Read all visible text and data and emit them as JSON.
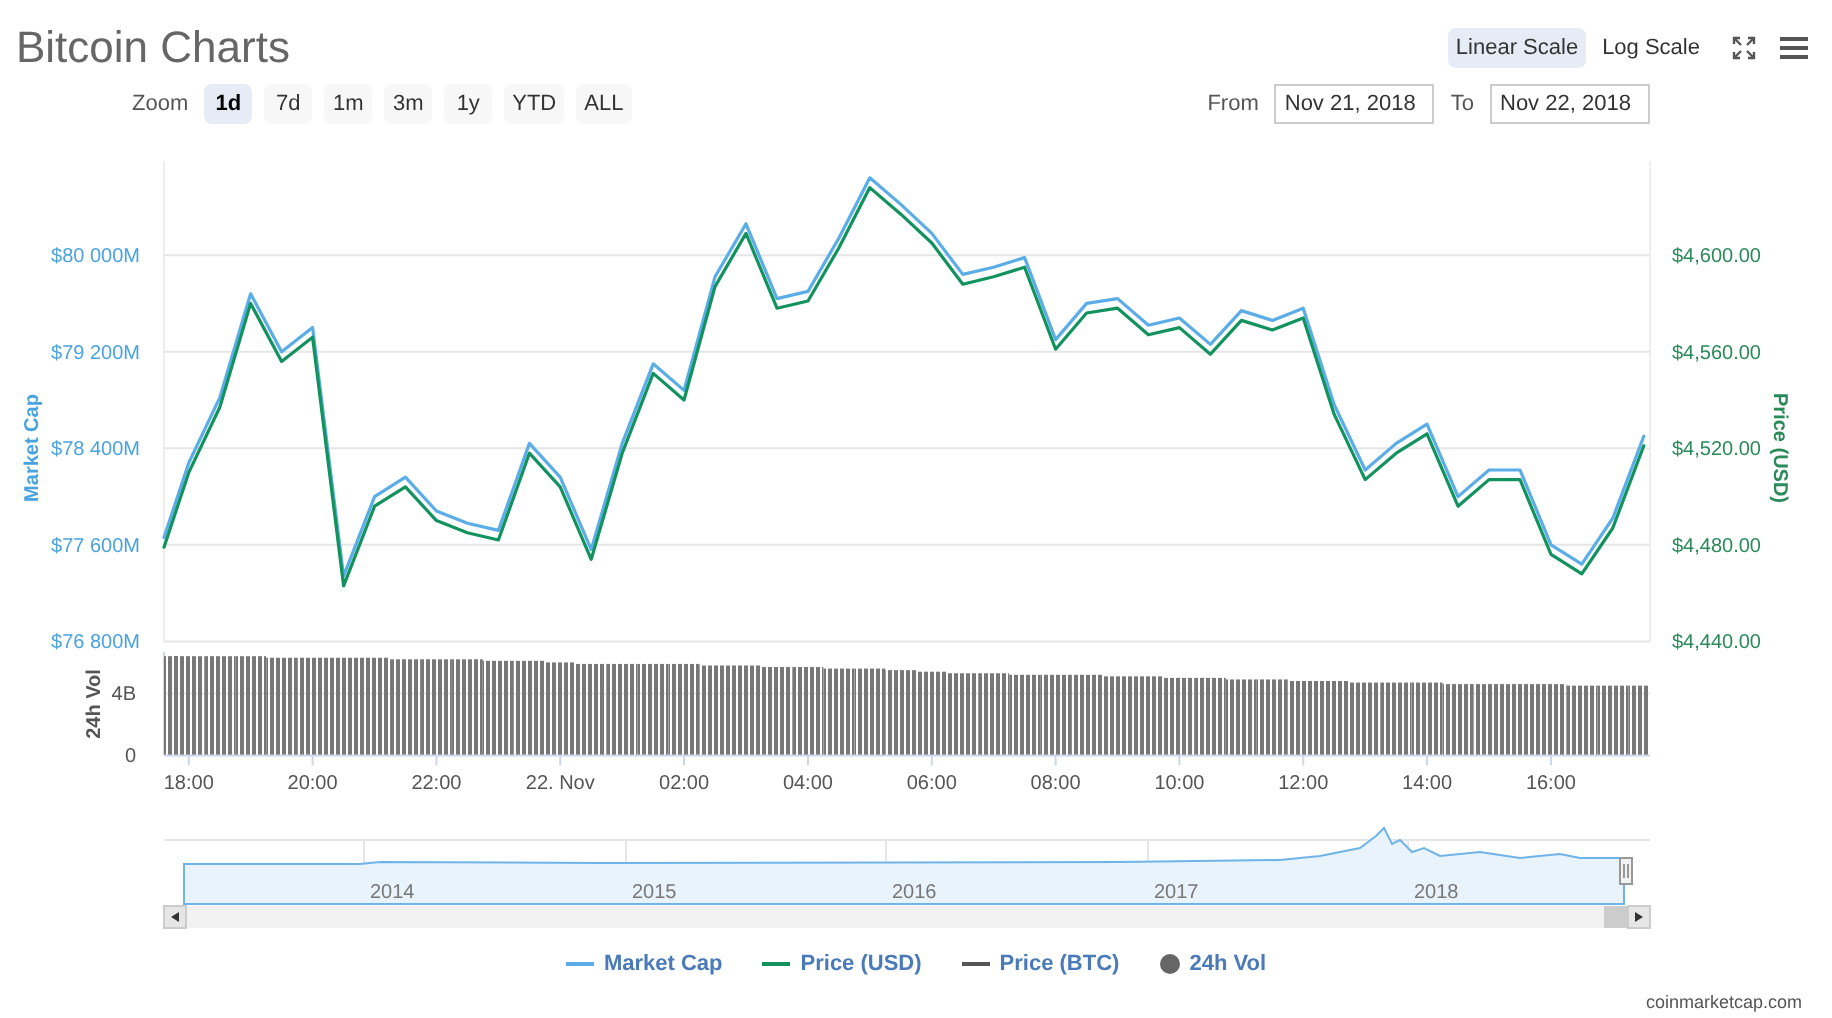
{
  "title": "Bitcoin Charts",
  "scale_buttons": [
    {
      "label": "Linear Scale",
      "selected": true
    },
    {
      "label": "Log Scale",
      "selected": false
    }
  ],
  "zoom": {
    "label": "Zoom",
    "options": [
      {
        "label": "1d",
        "selected": true
      },
      {
        "label": "7d",
        "selected": false
      },
      {
        "label": "1m",
        "selected": false
      },
      {
        "label": "3m",
        "selected": false
      },
      {
        "label": "1y",
        "selected": false
      },
      {
        "label": "YTD",
        "selected": false
      },
      {
        "label": "ALL",
        "selected": false
      }
    ]
  },
  "range": {
    "from_label": "From",
    "from": "Nov 21, 2018",
    "to_label": "To",
    "to": "Nov 22, 2018"
  },
  "price_chart": {
    "chart_data": {
      "type": "line",
      "ylabel": "Market Cap",
      "y2label": "Price (USD)",
      "xlim": [
        "2018-11-21 17:36",
        "2018-11-22 17:36"
      ],
      "ylim": [
        76800,
        80780
      ],
      "y2lim": [
        4440,
        4639
      ],
      "grid": true,
      "yticks": [
        {
          "value": 76800,
          "label": "$76 800M"
        },
        {
          "value": 77600,
          "label": "$77 600M"
        },
        {
          "value": 78400,
          "label": "$78 400M"
        },
        {
          "value": 79200,
          "label": "$79 200M"
        },
        {
          "value": 80000,
          "label": "$80 000M"
        }
      ],
      "y2ticks": [
        {
          "value": 4440,
          "label": "$4,440.00"
        },
        {
          "value": 4480,
          "label": "$4,480.00"
        },
        {
          "value": 4520,
          "label": "$4,520.00"
        },
        {
          "value": 4560,
          "label": "$4,560.00"
        },
        {
          "value": 4600,
          "label": "$4,600.00"
        }
      ],
      "x": [
        "2018-11-21 17:36",
        "2018-11-21 18:00",
        "2018-11-21 18:30",
        "2018-11-21 19:00",
        "2018-11-21 19:30",
        "2018-11-21 20:00",
        "2018-11-21 20:30",
        "2018-11-21 21:00",
        "2018-11-21 21:30",
        "2018-11-21 22:00",
        "2018-11-21 22:30",
        "2018-11-21 23:00",
        "2018-11-21 23:30",
        "2018-11-22 00:00",
        "2018-11-22 00:30",
        "2018-11-22 01:00",
        "2018-11-22 01:30",
        "2018-11-22 02:00",
        "2018-11-22 02:30",
        "2018-11-22 03:00",
        "2018-11-22 03:30",
        "2018-11-22 04:00",
        "2018-11-22 04:30",
        "2018-11-22 05:00",
        "2018-11-22 05:30",
        "2018-11-22 06:00",
        "2018-11-22 06:30",
        "2018-11-22 07:00",
        "2018-11-22 07:30",
        "2018-11-22 08:00",
        "2018-11-22 08:30",
        "2018-11-22 09:00",
        "2018-11-22 09:30",
        "2018-11-22 10:00",
        "2018-11-22 10:30",
        "2018-11-22 11:00",
        "2018-11-22 11:30",
        "2018-11-22 12:00",
        "2018-11-22 12:30",
        "2018-11-22 13:00",
        "2018-11-22 13:30",
        "2018-11-22 14:00",
        "2018-11-22 14:30",
        "2018-11-22 15:00",
        "2018-11-22 15:30",
        "2018-11-22 16:00",
        "2018-11-22 16:30",
        "2018-11-22 17:00",
        "2018-11-22 17:30"
      ],
      "series": [
        {
          "color": "#5aade6",
          "values": [
            77660,
            78280,
            78820,
            79680,
            79200,
            79400,
            77340,
            78000,
            78160,
            77880,
            77780,
            77720,
            78440,
            78160,
            77560,
            78440,
            79100,
            78880,
            79820,
            80260,
            79640,
            79700,
            80140,
            80640,
            80420,
            80180,
            79840,
            79900,
            79980,
            79300,
            79600,
            79640,
            79420,
            79480,
            79260,
            79540,
            79460,
            79560,
            78760,
            78220,
            78440,
            78600,
            78000,
            78220,
            78220,
            77600,
            77440,
            77820,
            78500
          ]
        },
        {
          "color": "#11925e",
          "axis": "y2",
          "values": [
            4479,
            4510,
            4537,
            4580,
            4556,
            4566,
            4463,
            4496,
            4504,
            4490,
            4485,
            4482,
            4518,
            4504,
            4474,
            4518,
            4551,
            4540,
            4587,
            4609,
            4578,
            4581,
            4603,
            4628,
            4617,
            4605,
            4588,
            4591,
            4595,
            4561,
            4576,
            4578,
            4567,
            4570,
            4559,
            4573,
            4569,
            4574,
            4534,
            4507,
            4518,
            4526,
            4496,
            4507,
            4507,
            4476,
            4468,
            4487,
            4521
          ]
        }
      ]
    }
  },
  "volume_chart": {
    "chart_data": {
      "type": "bar",
      "ylabel": "24h Vol",
      "xlim": [
        "2018-11-21 17:36",
        "2018-11-22 17:36"
      ],
      "ylim": [
        0,
        6.67
      ],
      "yticks": [
        {
          "value": 0,
          "label": "0"
        },
        {
          "value": 4,
          "label": "4B"
        }
      ],
      "xticks": [
        {
          "value": "2018-11-21 18:00",
          "label": "18:00"
        },
        {
          "value": "2018-11-21 20:00",
          "label": "20:00"
        },
        {
          "value": "2018-11-21 22:00",
          "label": "22:00"
        },
        {
          "value": "2018-11-22 00:00",
          "label": "22. Nov"
        },
        {
          "value": "2018-11-22 02:00",
          "label": "02:00"
        },
        {
          "value": "2018-11-22 04:00",
          "label": "04:00"
        },
        {
          "value": "2018-11-22 06:00",
          "label": "06:00"
        },
        {
          "value": "2018-11-22 08:00",
          "label": "08:00"
        },
        {
          "value": "2018-11-22 10:00",
          "label": "10:00"
        },
        {
          "value": "2018-11-22 12:00",
          "label": "12:00"
        },
        {
          "value": "2018-11-22 14:00",
          "label": "14:00"
        },
        {
          "value": "2018-11-22 16:00",
          "label": "16:00"
        }
      ],
      "x": [
        "2018-11-21 17:36",
        "2018-11-21 18:00",
        "2018-11-21 18:30",
        "2018-11-21 19:00",
        "2018-11-21 19:30",
        "2018-11-21 20:00",
        "2018-11-21 20:30",
        "2018-11-21 21:00",
        "2018-11-21 21:30",
        "2018-11-21 22:00",
        "2018-11-21 22:30",
        "2018-11-21 23:00",
        "2018-11-21 23:30",
        "2018-11-22 00:00",
        "2018-11-22 00:30",
        "2018-11-22 01:00",
        "2018-11-22 01:30",
        "2018-11-22 02:00",
        "2018-11-22 02:30",
        "2018-11-22 03:00",
        "2018-11-22 03:30",
        "2018-11-22 04:00",
        "2018-11-22 04:30",
        "2018-11-22 05:00",
        "2018-11-22 05:30",
        "2018-11-22 06:00",
        "2018-11-22 06:30",
        "2018-11-22 07:00",
        "2018-11-22 07:30",
        "2018-11-22 08:00",
        "2018-11-22 08:30",
        "2018-11-22 09:00",
        "2018-11-22 09:30",
        "2018-11-22 10:00",
        "2018-11-22 10:30",
        "2018-11-22 11:00",
        "2018-11-22 11:30",
        "2018-11-22 12:00",
        "2018-11-22 12:30",
        "2018-11-22 13:00",
        "2018-11-22 13:30",
        "2018-11-22 14:00",
        "2018-11-22 14:30",
        "2018-11-22 15:00",
        "2018-11-22 15:30",
        "2018-11-22 16:00",
        "2018-11-22 16:30",
        "2018-11-22 17:00",
        "2018-11-22 17:30"
      ],
      "series": [
        {
          "color": "#777777",
          "values": [
            6.4,
            6.4,
            6.4,
            6.4,
            6.3,
            6.3,
            6.3,
            6.3,
            6.2,
            6.2,
            6.2,
            6.1,
            6.1,
            6.0,
            5.9,
            5.9,
            5.9,
            5.9,
            5.8,
            5.8,
            5.7,
            5.7,
            5.6,
            5.6,
            5.5,
            5.4,
            5.3,
            5.3,
            5.2,
            5.2,
            5.2,
            5.1,
            5.1,
            5.0,
            5.0,
            4.9,
            4.9,
            4.8,
            4.8,
            4.7,
            4.7,
            4.7,
            4.6,
            4.6,
            4.6,
            4.6,
            4.5,
            4.5,
            4.5
          ]
        }
      ]
    }
  },
  "navigator": {
    "years": [
      "2014",
      "2015",
      "2016",
      "2017",
      "2018"
    ]
  },
  "legend": [
    {
      "label": "Market Cap",
      "kind": "line",
      "color": "#5aade6"
    },
    {
      "label": "Price (USD)",
      "kind": "line",
      "color": "#11925e"
    },
    {
      "label": "Price (BTC)",
      "kind": "line",
      "color": "#555555"
    },
    {
      "label": "24h Vol",
      "kind": "dot",
      "color": "#666666"
    }
  ],
  "credit": "coinmarketcap.com"
}
